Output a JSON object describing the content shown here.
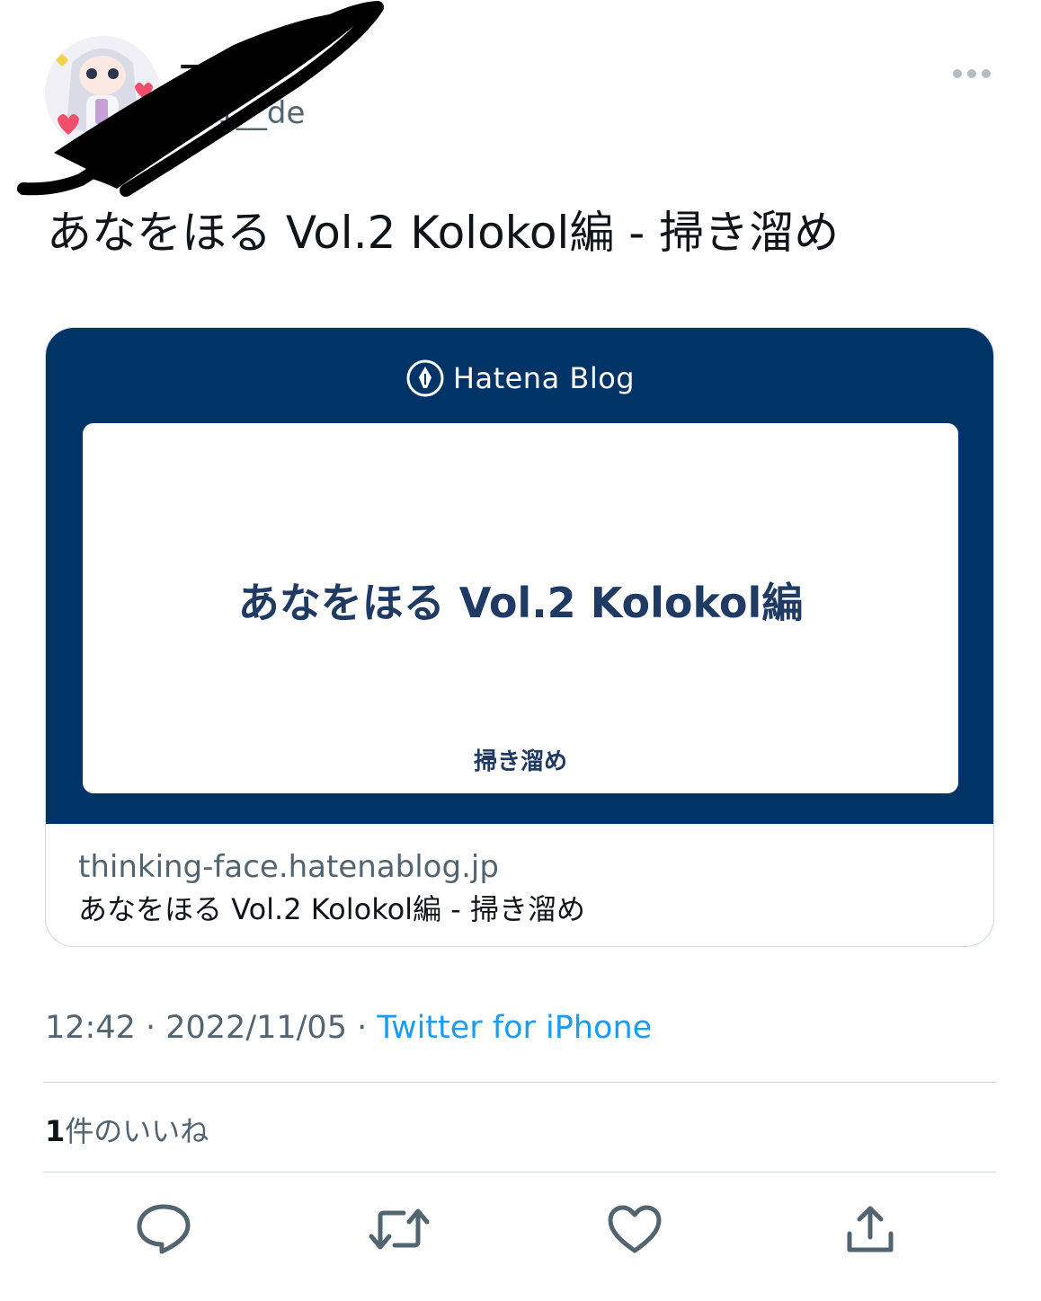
{
  "tweet": {
    "author": {
      "display_name": "天",
      "handle": "091__de"
    },
    "text": "あなをほる Vol.2 Kolokol編 - 掃き溜め",
    "timestamp": "12:42 · 2022/11/05 · ",
    "source": "Twitter for iPhone",
    "likes": {
      "count": "1",
      "label": "件のいいね"
    }
  },
  "link_card": {
    "brand": "Hatena Blog",
    "inner_title": "あなをほる Vol.2 Kolokol編",
    "inner_blog_name": "掃き溜め",
    "domain": "thinking-face.hatenablog.jp",
    "title": "あなをほる Vol.2 Kolokol編 - 掃き溜め"
  },
  "actions": [
    {
      "icon": "reply-icon"
    },
    {
      "icon": "retweet-icon"
    },
    {
      "icon": "like-icon"
    },
    {
      "icon": "share-icon"
    }
  ],
  "colors": {
    "banner": "#003366",
    "accent": "#1d9bf0",
    "secondary_text": "#536471",
    "icon": "#536471"
  }
}
